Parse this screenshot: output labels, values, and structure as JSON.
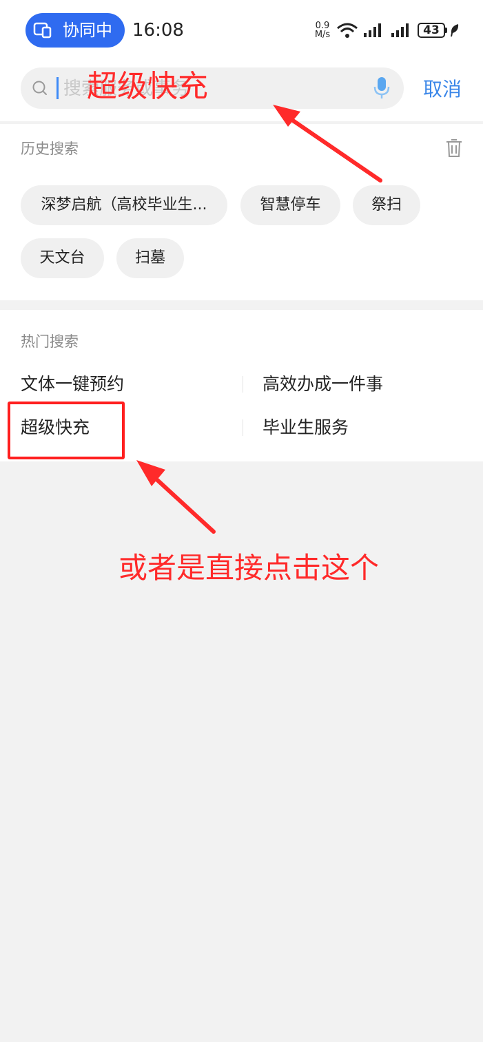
{
  "status_bar": {
    "collab_label": "协同中",
    "time": "16:08",
    "net_speed_value": "0.9",
    "net_speed_unit": "M/s",
    "battery": "43",
    "icons": [
      "collab-devices-icon",
      "wifi-icon",
      "signal-icon",
      "signal-icon",
      "battery-icon",
      "leaf-icon"
    ]
  },
  "search": {
    "placeholder": "搜索服务或事务",
    "value": "",
    "cancel_label": "取消"
  },
  "history": {
    "title": "历史搜索",
    "items": [
      "深梦启航（高校毕业生...",
      "智慧停车",
      "祭扫",
      "天文台",
      "扫墓"
    ]
  },
  "hot": {
    "title": "热门搜索",
    "items": [
      "文体一键预约",
      "高效办成一件事",
      "超级快充",
      "毕业生服务"
    ]
  },
  "annotations": {
    "top_text": "超级快充",
    "bottom_text": "或者是直接点击这个",
    "color": "#ff2a2a"
  },
  "colors": {
    "accent": "#2f6bf0",
    "link": "#3a86e8"
  }
}
